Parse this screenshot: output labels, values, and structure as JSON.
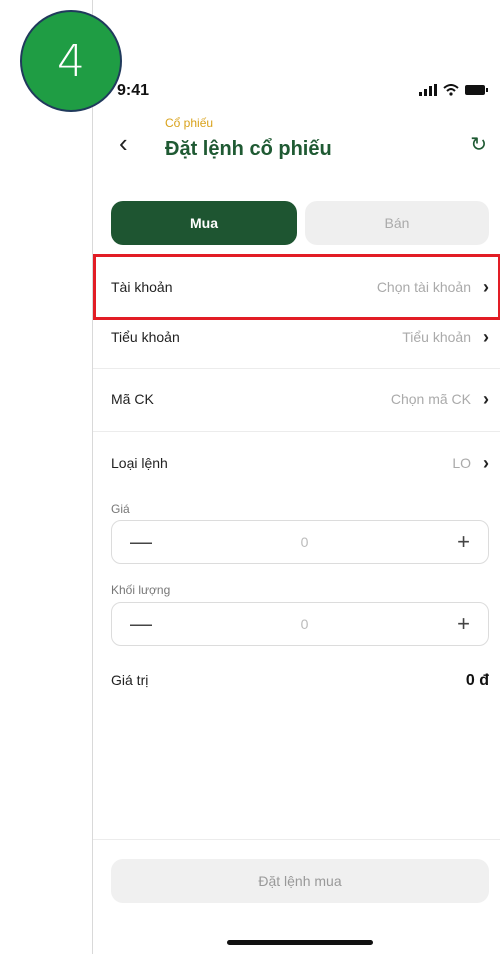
{
  "step_badge": "4",
  "status": {
    "time": "9:41",
    "icons": [
      "signal-icon",
      "wifi-icon",
      "battery-icon"
    ]
  },
  "header": {
    "subtitle": "Cổ phiếu",
    "title": "Đặt lệnh cổ phiếu",
    "back_icon": "chevron-left-icon",
    "refresh_icon": "refresh-icon"
  },
  "tabs": {
    "buy": "Mua",
    "sell": "Bán"
  },
  "fields": {
    "account": {
      "label": "Tài khoản",
      "value": "Chọn tài khoản"
    },
    "subaccount": {
      "label": "Tiểu khoản",
      "value": "Tiểu khoản"
    },
    "symbol": {
      "label": "Mã CK",
      "value": "Chọn mã CK"
    },
    "order_type": {
      "label": "Loại lệnh",
      "value": "LO"
    }
  },
  "price": {
    "label": "Giá",
    "value": "0",
    "minus": "—",
    "plus": "+"
  },
  "quantity": {
    "label": "Khối lượng",
    "value": "0",
    "minus": "—",
    "plus": "+"
  },
  "total": {
    "label": "Giá trị",
    "value": "0 đ"
  },
  "submit_label": "Đặt lệnh mua",
  "colors": {
    "primary": "#1e5531",
    "accent": "#d9a21b",
    "highlight": "#e21d25",
    "badge": "#1f9d44"
  }
}
